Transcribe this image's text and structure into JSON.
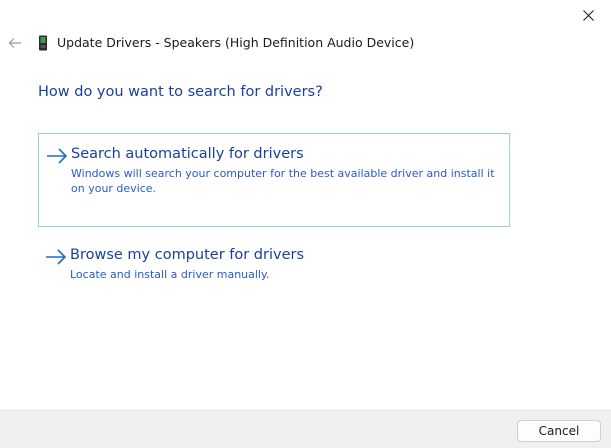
{
  "window": {
    "title": "Update Drivers - Speakers (High Definition Audio Device)",
    "close_icon": "close-icon",
    "back_icon": "back-arrow-icon",
    "device_icon": "speaker-device-icon"
  },
  "main": {
    "question": "How do you want to search for drivers?",
    "options": [
      {
        "title": "Search automatically for drivers",
        "description": "Windows will search your computer for the best available driver and install it on your device.",
        "icon": "arrow-right-icon"
      },
      {
        "title": "Browse my computer for drivers",
        "description": "Locate and install a driver manually.",
        "icon": "arrow-right-icon"
      }
    ]
  },
  "footer": {
    "cancel_label": "Cancel"
  },
  "colors": {
    "link": "#1a3f9e",
    "description": "#2a5bc8",
    "highlight_border": "#99cde8",
    "footer_bg": "#f0f0f0"
  }
}
